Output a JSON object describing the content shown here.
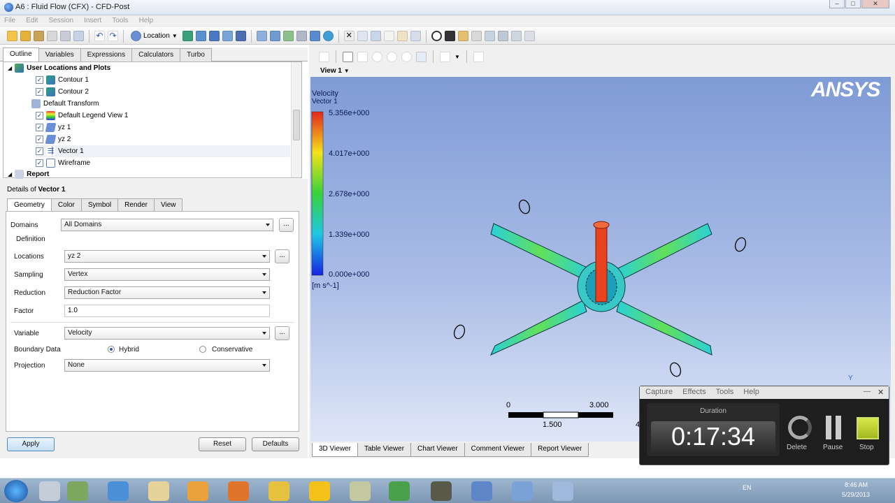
{
  "window": {
    "title": "A6 : Fluid Flow (CFX) - CFD-Post",
    "min_icon": "minimize-icon",
    "max_icon": "maximize-icon",
    "close_icon": "close-icon"
  },
  "menu": [
    "File",
    "Edit",
    "Session",
    "Insert",
    "Tools",
    "Help"
  ],
  "toolbar": {
    "location_label": "Location"
  },
  "left_tabs": [
    "Outline",
    "Variables",
    "Expressions",
    "Calculators",
    "Turbo"
  ],
  "tree": {
    "root": "User Locations and Plots",
    "items": [
      {
        "label": "Contour 1",
        "checked": true,
        "icon": "contour-icon"
      },
      {
        "label": "Contour 2",
        "checked": true,
        "icon": "contour-icon"
      },
      {
        "label": "Default Transform",
        "checked": null,
        "icon": "transform-icon"
      },
      {
        "label": "Default Legend View 1",
        "checked": true,
        "icon": "legend-icon"
      },
      {
        "label": "yz 1",
        "checked": true,
        "icon": "plane-icon"
      },
      {
        "label": "yz 2",
        "checked": true,
        "icon": "plane-icon"
      },
      {
        "label": "Vector 1",
        "checked": true,
        "icon": "vector-icon"
      },
      {
        "label": "Wireframe",
        "checked": true,
        "icon": "wireframe-icon"
      }
    ],
    "report": "Report"
  },
  "details": {
    "prefix": "Details of ",
    "object": "Vector 1",
    "tabs": [
      "Geometry",
      "Color",
      "Symbol",
      "Render",
      "View"
    ],
    "domains_label": "Domains",
    "domains_value": "All Domains",
    "definition_label": "Definition",
    "locations_label": "Locations",
    "locations_value": "yz 2",
    "sampling_label": "Sampling",
    "sampling_value": "Vertex",
    "reduction_label": "Reduction",
    "reduction_value": "Reduction Factor",
    "factor_label": "Factor",
    "factor_value": "1.0",
    "variable_label": "Variable",
    "variable_value": "Velocity",
    "boundary_label": "Boundary Data",
    "hybrid_label": "Hybrid",
    "conservative_label": "Conservative",
    "projection_label": "Projection",
    "projection_value": "None",
    "more": "...",
    "apply": "Apply",
    "reset": "Reset",
    "defaults": "Defaults"
  },
  "viewer": {
    "view_title": "View 1",
    "logo": "ANSYS",
    "legend": {
      "title1": "Velocity",
      "title2": "Vector 1",
      "ticks": [
        "5.356e+000",
        "4.017e+000",
        "2.678e+000",
        "1.339e+000",
        "0.000e+000"
      ],
      "unit": "[m s^-1]"
    },
    "scale": {
      "top": [
        "0",
        "3.000"
      ],
      "bottom": [
        "1.500",
        "4"
      ]
    },
    "axis_label": "Y",
    "tabs": [
      "3D Viewer",
      "Table Viewer",
      "Chart Viewer",
      "Comment Viewer",
      "Report Viewer"
    ]
  },
  "recorder": {
    "menu": [
      "Capture",
      "Effects",
      "Tools",
      "Help"
    ],
    "duration_label": "Duration",
    "time": "0:17:34",
    "delete": "Delete",
    "pause": "Pause",
    "stop": "Stop"
  },
  "taskbar": {
    "lang": "EN",
    "time": "8:46 AM",
    "date": "5/29/2013"
  }
}
